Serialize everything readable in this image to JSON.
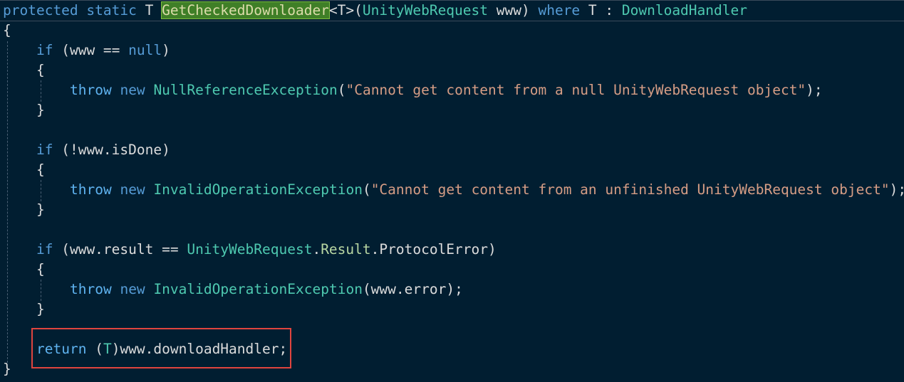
{
  "code": {
    "signature": {
      "protected": "protected",
      "static": "static",
      "ret_type": "T",
      "method": "GetCheckedDownloader",
      "generic": "<T>(",
      "param_type": "UnityWebRequest",
      "param_name": " www) ",
      "where": "where",
      "t2": " T : ",
      "constraint": "DownloadHandler"
    },
    "open_brace": "{",
    "close_brace": "}",
    "if1": {
      "kw": "if",
      "cond_a": " (www == ",
      "null": "null",
      "cond_b": ")",
      "open": "{",
      "throw": "throw",
      "new": "new",
      "exc": "NullReferenceException",
      "paren_open": "(",
      "msg": "\"Cannot get content from a null UnityWebRequest object\"",
      "paren_close": ");",
      "close": "}"
    },
    "if2": {
      "kw": "if",
      "cond": " (!www.isDone)",
      "open": "{",
      "throw": "throw",
      "new": "new",
      "exc": "InvalidOperationException",
      "paren_open": "(",
      "msg": "\"Cannot get content from an unfinished UnityWebRequest object\"",
      "paren_close": ");",
      "close": "}"
    },
    "if3": {
      "kw": "if",
      "cond_a": " (www.result == ",
      "type": "UnityWebRequest",
      "dot1": ".",
      "result": "Result",
      "dot2": ".ProtocolError)",
      "open": "{",
      "throw": "throw",
      "new": "new",
      "exc": "InvalidOperationException",
      "args": "(www.error);",
      "close": "}"
    },
    "ret": {
      "kw": "return",
      "cast_open": " (",
      "cast_type": "T",
      "rest": ")www.downloadHandler;"
    }
  },
  "colors": {
    "background": "#011e31",
    "keyword": "#569cd6",
    "type": "#4ec9b0",
    "string": "#d69d85",
    "highlight_box": "#e0443e",
    "method_highlight": "#3f7f27"
  }
}
